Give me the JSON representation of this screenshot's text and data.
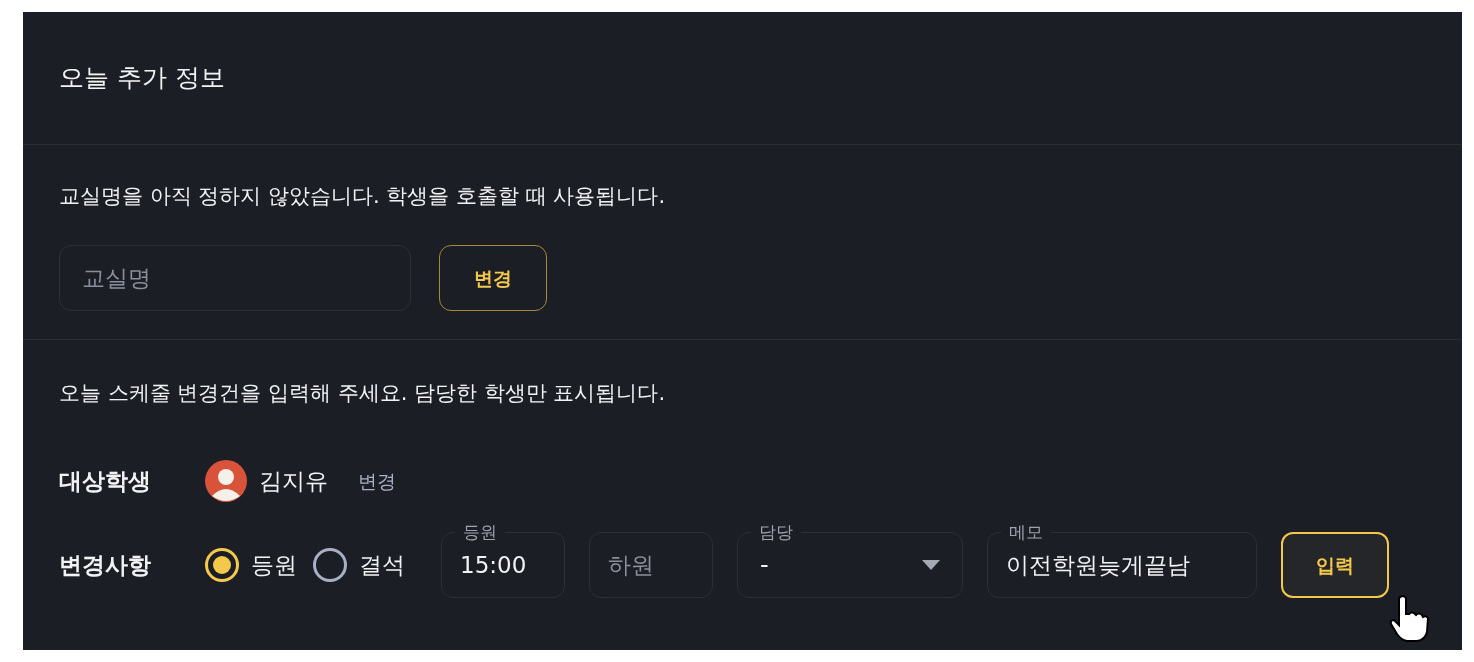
{
  "panel_title": "오늘 추가 정보",
  "classroom": {
    "notice": "교실명을 아직 정하지 않았습니다. 학생을 호출할 때 사용됩니다.",
    "field": {
      "placeholder": "교실명"
    },
    "button": "변경"
  },
  "schedule": {
    "notice": "오늘 스케줄 변경건을 입력해 주세요. 담당한 학생만 표시됩니다.",
    "student": {
      "label": "대상학생",
      "name": "김지유",
      "change_link": "변경"
    },
    "change": {
      "label": "변경사항",
      "options": [
        {
          "label": "등원",
          "selected": true
        },
        {
          "label": "결석",
          "selected": false
        }
      ],
      "fields": [
        {
          "kind": "text",
          "label": "등원",
          "value": "15:00"
        },
        {
          "kind": "text",
          "placeholder": "하원"
        },
        {
          "kind": "select",
          "label": "담당",
          "value": "-"
        },
        {
          "kind": "text",
          "label": "메모",
          "value": "이전학원늦게끝남"
        }
      ],
      "submit": "입력"
    }
  }
}
